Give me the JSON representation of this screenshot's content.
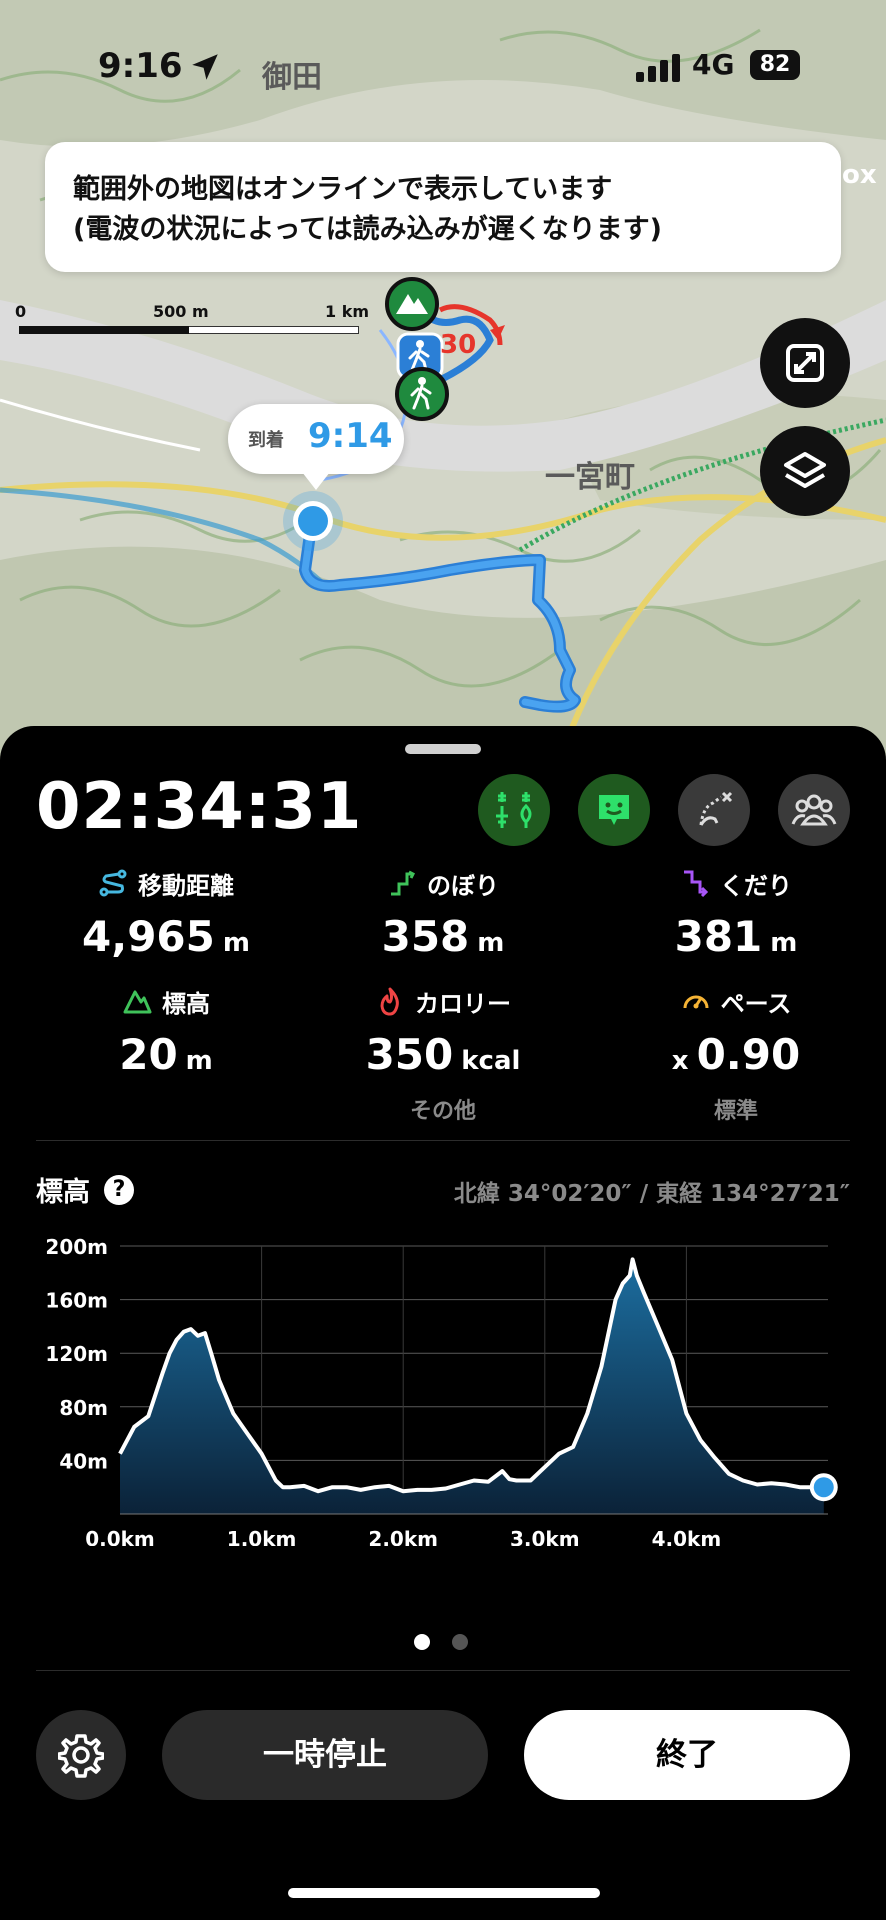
{
  "status_bar": {
    "time": "9:16",
    "network": "4G",
    "battery": "82"
  },
  "map": {
    "banner_lines": [
      "範囲外の地図はオンラインで表示しています",
      "(電波の状況によっては読み込みが遅くなります)"
    ],
    "banner_edge_text": "ox",
    "scale_labels": [
      "0",
      "500 m",
      "1 km"
    ],
    "place_labels": [
      "御田",
      "一宮町"
    ],
    "arrival_label": "到着",
    "arrival_time": "9:14",
    "marker_number": "30",
    "icons": [
      "mountain-icon",
      "hiker-icon",
      "hiker-icon",
      "expand-icon",
      "layers-icon"
    ]
  },
  "tracker": {
    "elapsed": "02:34:31",
    "tools": [
      "distance-markers-icon",
      "chat-face-icon",
      "route-deviation-icon",
      "group-icon"
    ],
    "stats": [
      {
        "label": "移動距離",
        "value": "4,965",
        "unit": "m",
        "icon": "distance-icon",
        "color": "#46b8e0"
      },
      {
        "label": "のぼり",
        "value": "358",
        "unit": "m",
        "icon": "ascent-icon",
        "color": "#3fc25a"
      },
      {
        "label": "くだり",
        "value": "381",
        "unit": "m",
        "icon": "descent-icon",
        "color": "#a855f7"
      },
      {
        "label": "標高",
        "value": "20",
        "unit": "m",
        "icon": "elevation-icon",
        "color": "#3fc25a"
      },
      {
        "label": "カロリー",
        "value": "350",
        "unit": "kcal",
        "icon": "fire-icon",
        "color": "#ef4444",
        "sub": "その他"
      },
      {
        "label": "ペース",
        "value": "0.90",
        "prefix": "x",
        "icon": "speedometer-icon",
        "color": "#f5b335",
        "sub": "標準"
      }
    ],
    "elevation_title": "標高",
    "help_mark": "?",
    "coordinates": "北緯 34°02′20″ / 東経 134°27′21″",
    "pause_label": "一時停止",
    "end_label": "終了"
  },
  "chart_data": {
    "type": "area",
    "title": "標高",
    "xlabel": "",
    "ylabel": "",
    "x_unit": "km",
    "y_unit": "m",
    "xlim": [
      0,
      5.0
    ],
    "ylim": [
      0,
      200
    ],
    "x_ticks": [
      "0.0km",
      "1.0km",
      "2.0km",
      "3.0km",
      "4.0km"
    ],
    "y_ticks": [
      "200m",
      "160m",
      "120m",
      "80m",
      "40m"
    ],
    "grid": true,
    "series": [
      {
        "x": [
          0.0,
          0.1,
          0.2,
          0.3,
          0.35,
          0.4,
          0.45,
          0.5,
          0.55,
          0.6,
          0.65,
          0.7,
          0.8,
          0.9,
          1.0,
          1.1,
          1.15,
          1.2,
          1.3,
          1.4,
          1.5,
          1.6,
          1.7,
          1.8,
          1.9,
          2.0,
          2.1,
          2.2,
          2.3,
          2.4,
          2.5,
          2.6,
          2.7,
          2.75,
          2.8,
          2.9,
          3.0,
          3.1,
          3.2,
          3.3,
          3.4,
          3.45,
          3.5,
          3.55,
          3.6,
          3.62,
          3.65,
          3.7,
          3.8,
          3.9,
          4.0,
          4.1,
          4.2,
          4.3,
          4.4,
          4.5,
          4.6,
          4.7,
          4.8,
          4.97
        ],
        "y": [
          45,
          65,
          73,
          105,
          120,
          130,
          136,
          138,
          133,
          135,
          118,
          100,
          75,
          60,
          45,
          25,
          20,
          20,
          21,
          17,
          20,
          20,
          18,
          20,
          21,
          17,
          18,
          18,
          19,
          22,
          25,
          24,
          32,
          26,
          25,
          25,
          35,
          45,
          50,
          75,
          110,
          135,
          160,
          172,
          178,
          190,
          178,
          165,
          140,
          115,
          75,
          55,
          42,
          30,
          25,
          22,
          23,
          22,
          20,
          20
        ]
      }
    ]
  }
}
